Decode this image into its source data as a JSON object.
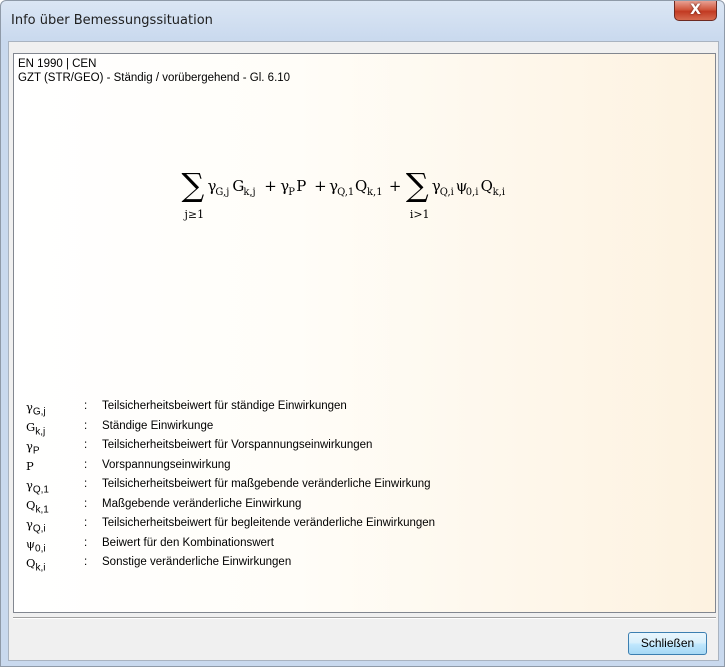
{
  "window": {
    "title": "Info über Bemessungssituation",
    "close_glyph": "X"
  },
  "panel": {
    "norm": "EN 1990 | CEN",
    "situation": "GZT (STR/GEO) - Ständig / vorübergehend - Gl. 6.10"
  },
  "formula": {
    "sum1_sub": "j≥1",
    "sum2_sub": "i>1",
    "term_g": "γ",
    "term_g_sub": "G,j",
    "term_G": "G",
    "term_G_sub": "k,j",
    "plus": "+",
    "term_p": "γ",
    "term_p_sub": "P",
    "term_P": "P",
    "term_q1": "γ",
    "term_q1_sub": "Q,1",
    "term_Q1": "Q",
    "term_Q1_sub": "k,1",
    "term_qi": "γ",
    "term_qi_sub": "Q,i",
    "term_psi": "ψ",
    "term_psi_sub": "0,i",
    "term_Qi": "Q",
    "term_Qi_sub": "k,i"
  },
  "legend": [
    {
      "sym": "γ",
      "sub": "G,j",
      "desc": "Teilsicherheitsbeiwert für ständige Einwirkungen"
    },
    {
      "sym": "G",
      "sub": "k,j",
      "desc": "Ständige Einwirkunge"
    },
    {
      "sym": "γ",
      "sub": "P",
      "desc": "Teilsicherheitsbeiwert für Vorspannungseinwirkungen"
    },
    {
      "sym": "P",
      "sub": "",
      "desc": "Vorspannungseinwirkung"
    },
    {
      "sym": "γ",
      "sub": "Q,1",
      "desc": "Teilsicherheitsbeiwert für maßgebende veränderliche Einwirkung"
    },
    {
      "sym": "Q",
      "sub": "k,1",
      "desc": "Maßgebende veränderliche Einwirkung"
    },
    {
      "sym": "γ",
      "sub": "Q,i",
      "desc": "Teilsicherheitsbeiwert für begleitende veränderliche Einwirkungen"
    },
    {
      "sym": "ψ",
      "sub": "0,i",
      "desc": "Beiwert für den Kombinationswert"
    },
    {
      "sym": "Q",
      "sub": "k,i",
      "desc": "Sonstige veränderliche Einwirkungen"
    }
  ],
  "legend_colon": ":",
  "buttons": {
    "close_label": "Schließen"
  }
}
